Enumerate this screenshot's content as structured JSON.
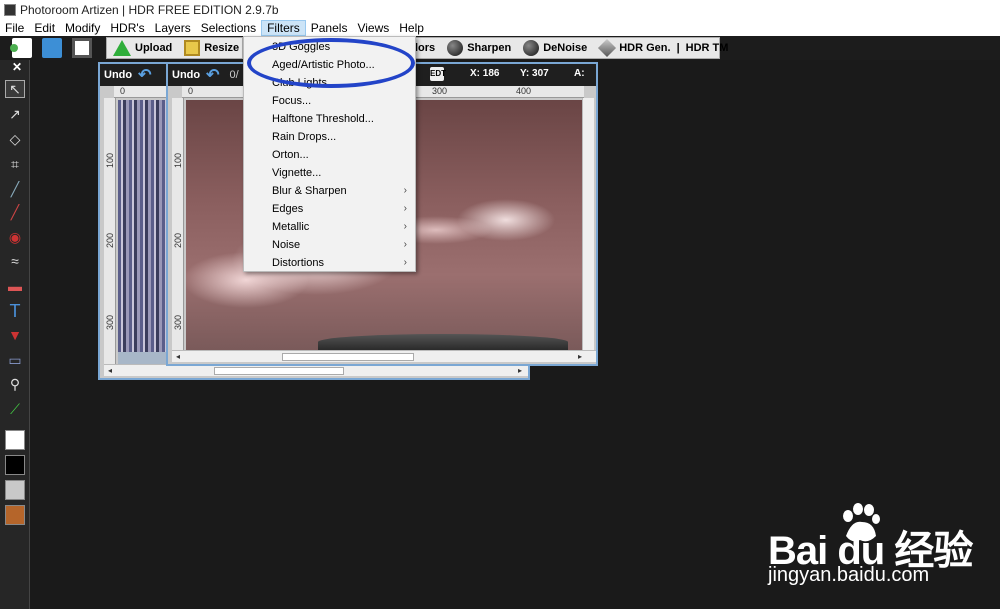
{
  "window": {
    "title": "Photoroom Artizen | HDR FREE EDITION 2.9.7b"
  },
  "menubar": {
    "items": [
      {
        "label": "File"
      },
      {
        "label": "Edit"
      },
      {
        "label": "Modify"
      },
      {
        "label": "HDR's"
      },
      {
        "label": "Layers"
      },
      {
        "label": "Selections"
      },
      {
        "label": "Filters"
      },
      {
        "label": "Panels"
      },
      {
        "label": "Views"
      },
      {
        "label": "Help"
      }
    ],
    "active": "Filters"
  },
  "toolbar": {
    "upload": "Upload",
    "resize": "Resize",
    "colors_partial": "lors",
    "sharpen": "Sharpen",
    "denoise": "DeNoise",
    "hdr_gen": "HDR Gen.",
    "separator": "|",
    "hdr_tm": "HDR TM"
  },
  "image_windows": {
    "back": {
      "undo": "Undo",
      "ruler_h": [
        "0"
      ],
      "ruler_v": [
        "100",
        "200",
        "300"
      ]
    },
    "front": {
      "undo": "Undo",
      "partial": "0/",
      "x_label": "X: 186",
      "y_label": "Y: 307",
      "a_label": "A:",
      "ruler_h": [
        "0",
        "300",
        "400"
      ],
      "ruler_v": [
        "100",
        "200",
        "300"
      ],
      "eyedrop_text": "EDT"
    }
  },
  "filters_menu": {
    "items": [
      {
        "label": "3D Goggles",
        "submenu": false
      },
      {
        "label": "Aged/Artistic Photo...",
        "submenu": false
      },
      {
        "label": "Club Lights...",
        "submenu": false
      },
      {
        "label": "Focus...",
        "submenu": false
      },
      {
        "label": "Halftone Threshold...",
        "submenu": false
      },
      {
        "label": "Rain Drops...",
        "submenu": false
      },
      {
        "label": "Orton...",
        "submenu": false
      },
      {
        "label": "Vignette...",
        "submenu": false
      },
      {
        "label": "Blur & Sharpen",
        "submenu": true
      },
      {
        "label": "Edges",
        "submenu": true
      },
      {
        "label": "Metallic",
        "submenu": true
      },
      {
        "label": "Noise",
        "submenu": true
      },
      {
        "label": "Distortions",
        "submenu": true
      }
    ],
    "submenu_glyph": "›"
  },
  "lefttools": {
    "close": "✕",
    "text_tool": "T"
  },
  "watermark": {
    "brand": "Bai du 经验",
    "site": "jingyan.baidu.com"
  },
  "colors": {
    "annotation": "#2344c8",
    "menu_active_bg": "#cce4f7",
    "app_bg": "#1a1a1a"
  }
}
